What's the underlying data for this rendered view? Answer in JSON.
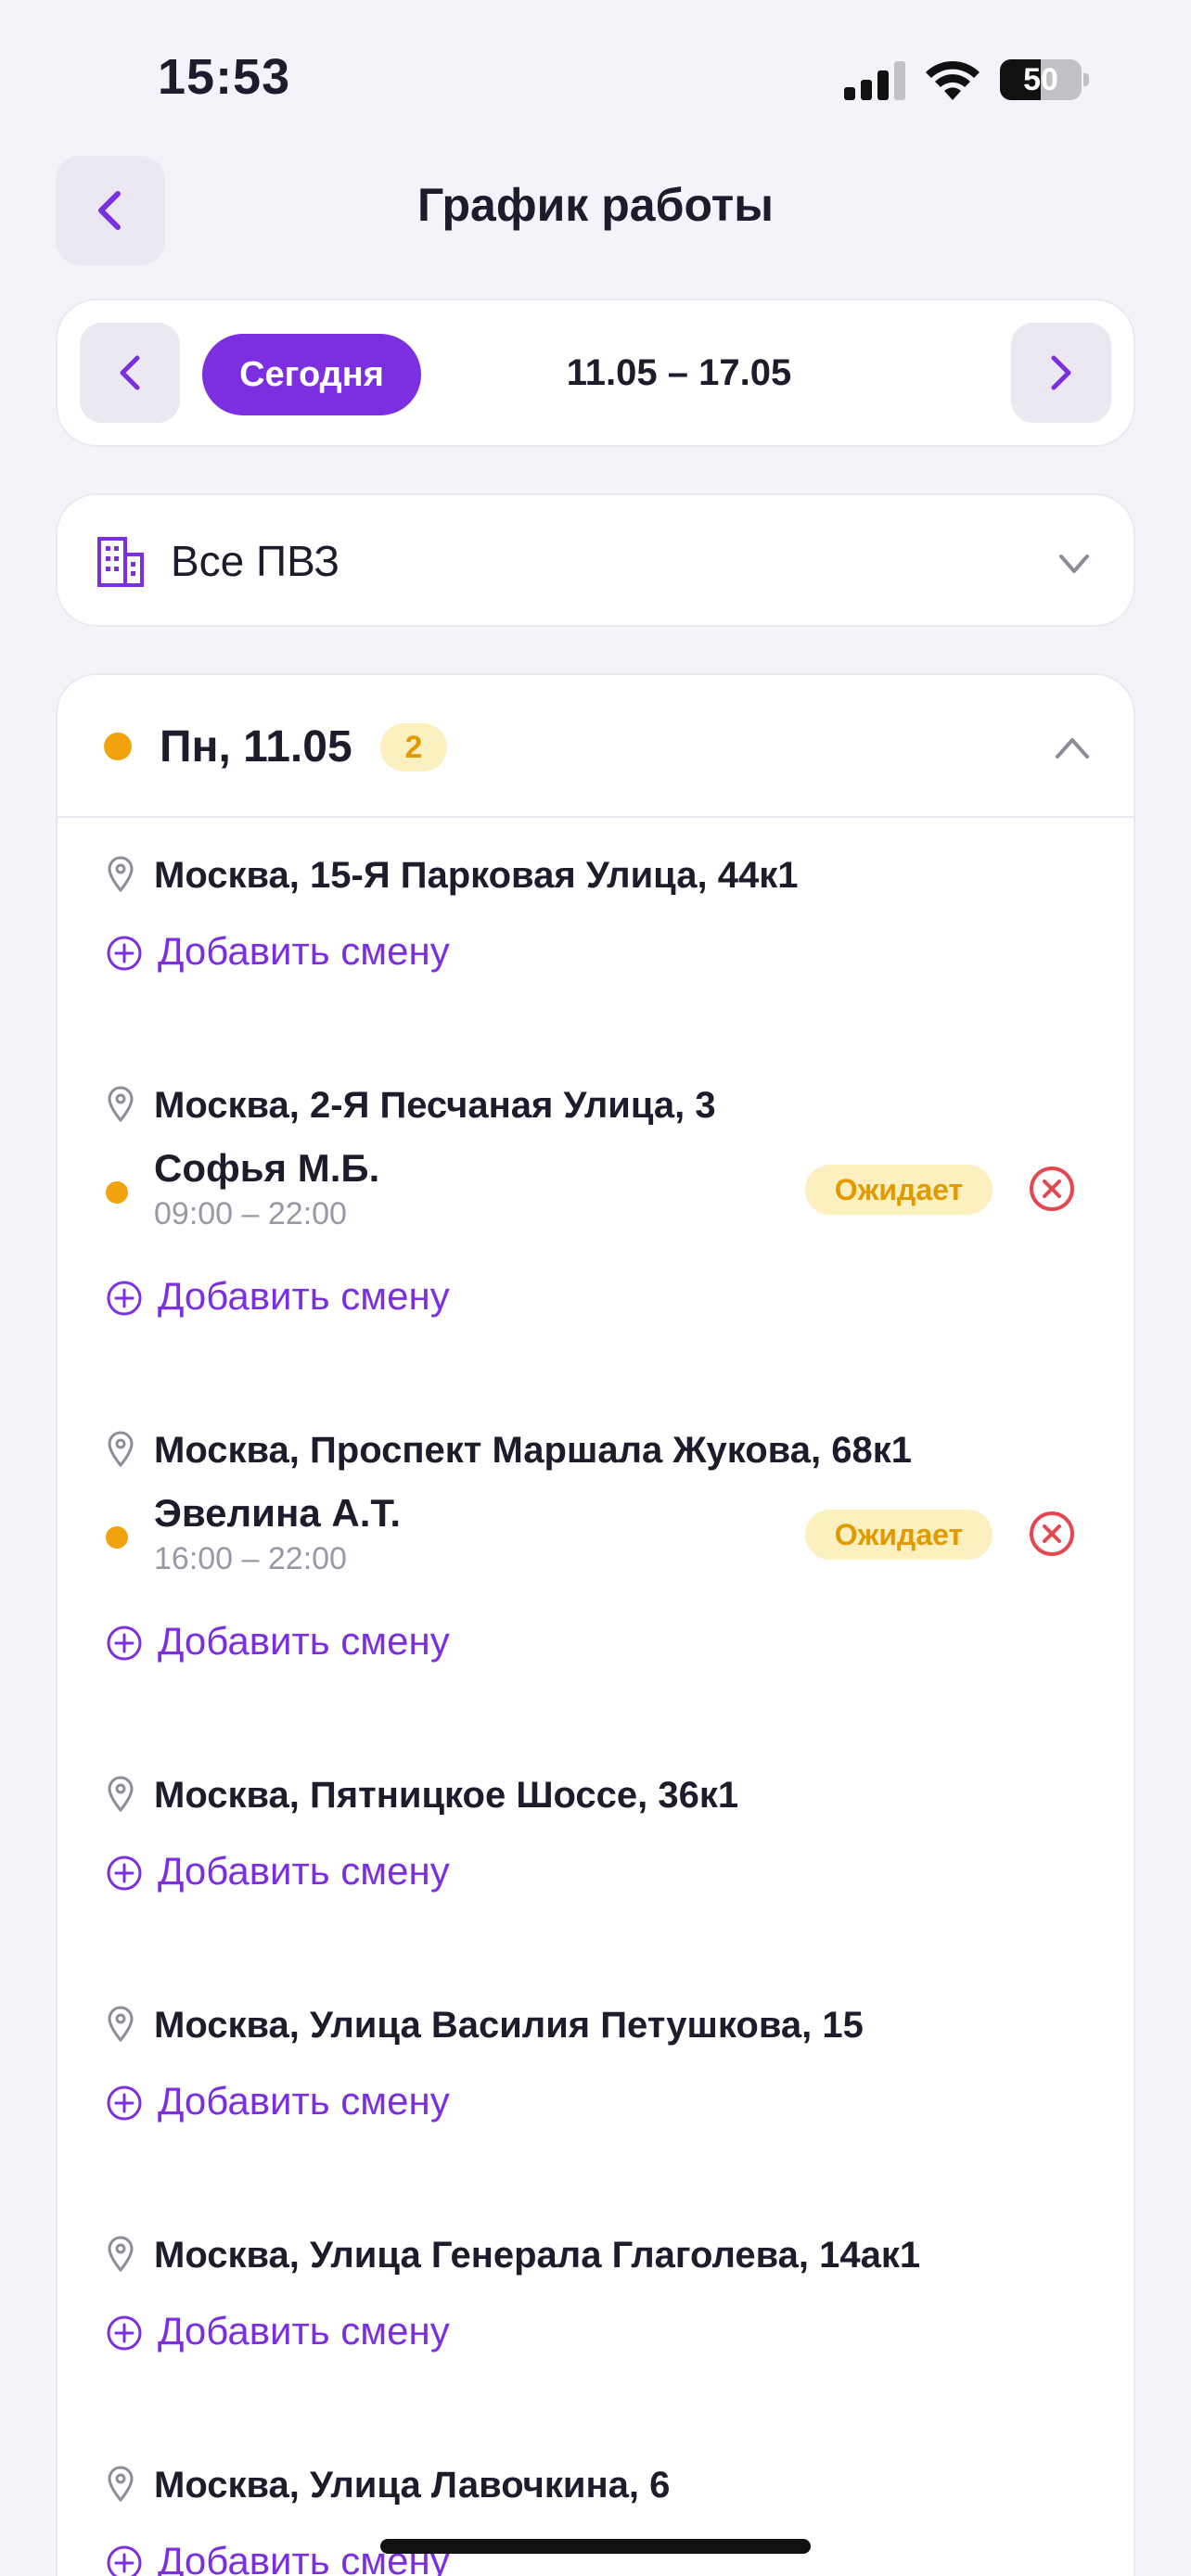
{
  "status_bar": {
    "time": "15:53",
    "battery": "50",
    "battery_level": 0.5
  },
  "header": {
    "title": "График работы",
    "back_icon": "chevron-left-icon"
  },
  "week": {
    "today_label": "Сегодня",
    "range": "11.05 – 17.05"
  },
  "pvz": {
    "label": "Все ПВЗ",
    "icon": "building-icon"
  },
  "colors": {
    "accent": "#7b2fe0",
    "pending": "#f2a20c",
    "pending_bg": "#fdf0c0",
    "danger": "#e5474e"
  },
  "day": {
    "title": "Пн, 11.05",
    "count": "2",
    "locations": [
      {
        "address": "Москва, 15-Я Парковая Улица, 44к1",
        "shifts": [],
        "add_label": "Добавить смену"
      },
      {
        "address": "Москва, 2-Я Песчаная Улица, 3",
        "shifts": [
          {
            "name": "Софья М.Б.",
            "time": "09:00 – 22:00",
            "status": "Ожидает"
          }
        ],
        "add_label": "Добавить смену"
      },
      {
        "address": "Москва, Проспект Маршала Жукова, 68к1",
        "shifts": [
          {
            "name": "Эвелина А.Т.",
            "time": "16:00 – 22:00",
            "status": "Ожидает"
          }
        ],
        "add_label": "Добавить смену"
      },
      {
        "address": "Москва, Пятницкое Шоссе, 36к1",
        "shifts": [],
        "add_label": "Добавить смену"
      },
      {
        "address": "Москва, Улица Василия Петушкова, 15",
        "shifts": [],
        "add_label": "Добавить смену"
      },
      {
        "address": "Москва, Улица Генерала Глаголева, 14ак1",
        "shifts": [],
        "add_label": "Добавить смену"
      },
      {
        "address": "Москва, Улица Лавочкина, 6",
        "shifts": [],
        "add_label": "Добавить смену"
      }
    ]
  }
}
